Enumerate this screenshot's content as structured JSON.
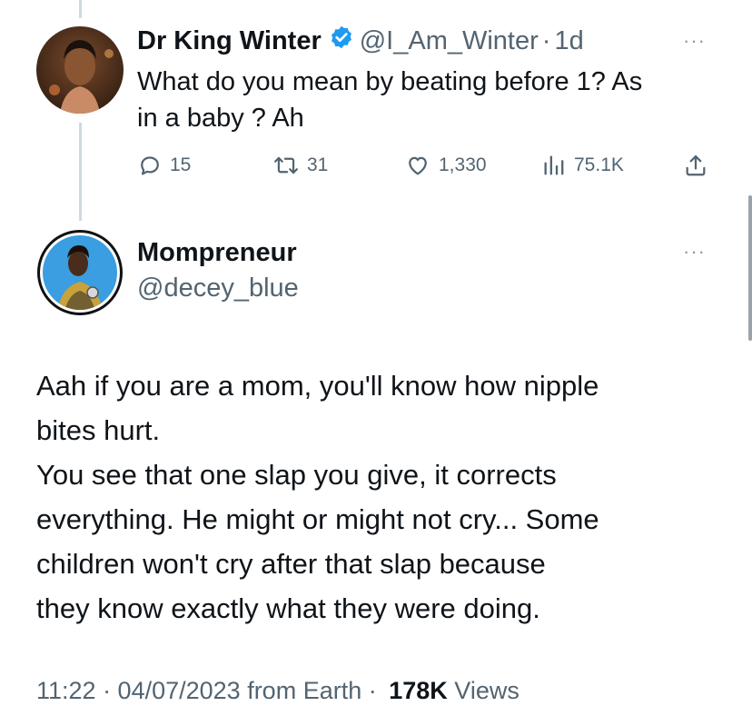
{
  "reply_to": {
    "name": "Dr King Winter",
    "handle": "@I_Am_Winter",
    "separator": "·",
    "time_ago": "1d",
    "text_line1": "What do you mean by beating before 1? As",
    "text_line2": "in a baby ? Ah",
    "replies": "15",
    "reposts": "31",
    "likes": "1,330",
    "views": "75.1K",
    "verified_color": "#1d9bf0"
  },
  "tweet": {
    "name": "Mompreneur",
    "handle": "@decey_blue",
    "lines": [
      "Aah if you are a mom, you'll know how nipple",
      "bites hurt.",
      "You see that one slap you give, it corrects",
      "everything. He might or might not cry... Some",
      "children won't cry after that slap because",
      "they know exactly what they were doing."
    ],
    "timestamp": "11:22 · 04/07/2023 from Earth ·",
    "views_count": "178K",
    "views_label": "Views"
  },
  "more_glyph": "···",
  "colors": {
    "text": "#0f1419",
    "secondary": "#536471",
    "thread": "#cfd9de",
    "avatar_ring": "#1d9bf0"
  }
}
